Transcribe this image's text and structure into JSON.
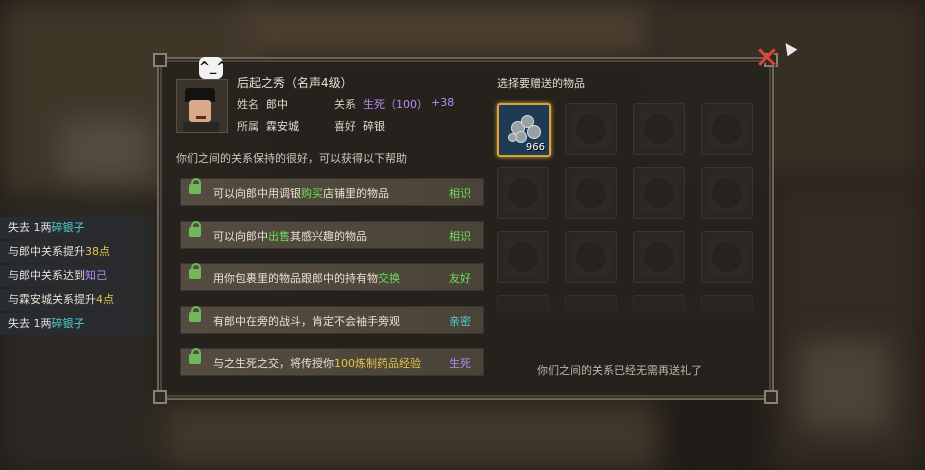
{
  "npc": {
    "title": "后起之秀（名声4级）",
    "name_label": "姓名",
    "name": "郎中",
    "relation_label": "关系",
    "relation_value": "生死（100）",
    "relation_bonus": "+38",
    "affiliation_label": "所属",
    "affiliation": "霖安城",
    "preference_label": "喜好",
    "preference": "碎银",
    "emote": "^_^"
  },
  "help_header": "你们之间的关系保持的很好，可以获得以下帮助",
  "benefits": [
    {
      "pre": "可以向郎中用调银",
      "hl": "购买",
      "post": "店铺里的物品",
      "level": "相识",
      "hl_color": "green",
      "level_color": "green"
    },
    {
      "pre": "可以向郎中",
      "hl": "出售",
      "post": "其感兴趣的物品",
      "level": "相识",
      "hl_color": "green",
      "level_color": "green"
    },
    {
      "pre": "用你包裹里的物品跟郎中的持有物",
      "hl": "交换",
      "post": "",
      "level": "友好",
      "hl_color": "green",
      "level_color": "green"
    },
    {
      "pre": "有郎中在旁的战斗，肯定不会袖手旁观",
      "hl": "",
      "post": "",
      "level": "亲密",
      "hl_color": "teal",
      "level_color": "teal"
    },
    {
      "pre": "与之生死之交，将传授你",
      "hl": "100炼制药品经验",
      "post": "",
      "level": "生死",
      "hl_color": "yellow",
      "level_color": "purple"
    }
  ],
  "gift": {
    "title": "选择要赠送的物品",
    "item_count": "966",
    "item_icon": "silver-ore-icon",
    "footer": "你们之间的关系已经无需再送礼了"
  },
  "log": [
    {
      "parts": [
        {
          "t": "失去 1两",
          "c": "#e8e2d4"
        },
        {
          "t": "碎银子",
          "c": "#4fd1d0"
        }
      ]
    },
    {
      "parts": [
        {
          "t": "与郎中关系提升",
          "c": "#e8e2d4"
        },
        {
          "t": "38点",
          "c": "#e3c54a"
        }
      ]
    },
    {
      "parts": [
        {
          "t": "与郎中关系达到",
          "c": "#e8e2d4"
        },
        {
          "t": "知己",
          "c": "#b78cf0"
        }
      ]
    },
    {
      "parts": [
        {
          "t": "与霖安城关系提升",
          "c": "#e8e2d4"
        },
        {
          "t": "4点",
          "c": "#e3c54a"
        }
      ]
    },
    {
      "parts": [
        {
          "t": "失去 1两",
          "c": "#e8e2d4"
        },
        {
          "t": "碎银子",
          "c": "#4fd1d0"
        }
      ]
    }
  ],
  "colors": {
    "green": "#6ee05a",
    "teal": "#4fd1d0",
    "yellow": "#e3c54a",
    "purple": "#b78cf0",
    "close": "#d8453b",
    "slot_highlight": "#d9a23b"
  }
}
